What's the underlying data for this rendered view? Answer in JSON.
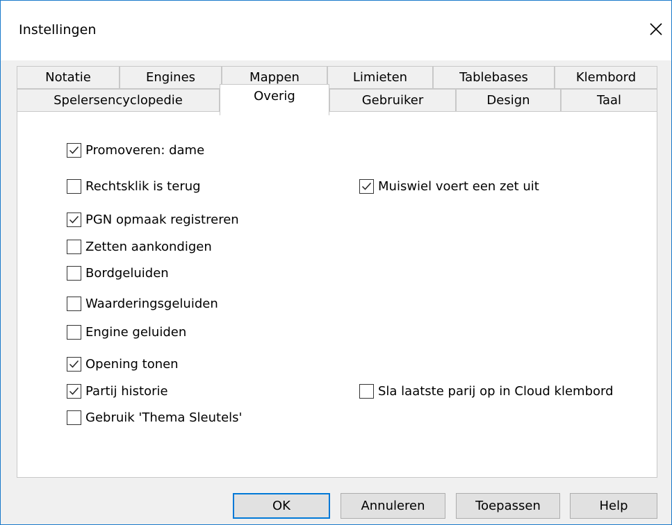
{
  "window": {
    "title": "Instellingen"
  },
  "tabs_row1": [
    "Notatie",
    "Engines",
    "Mappen",
    "Limieten",
    "Tablebases",
    "Klembord"
  ],
  "tabs_row2": [
    "Spelersencyclopedie",
    "Overig",
    "Gebruiker",
    "Design",
    "Taal"
  ],
  "selected_tab": "Overig",
  "options": [
    {
      "label": "Promoveren: dame",
      "checked": true
    },
    {
      "label": "Rechtsklik is terug",
      "checked": false
    },
    {
      "label": "Muiswiel voert een zet uit",
      "checked": true
    },
    {
      "label": "PGN opmaak registreren",
      "checked": true
    },
    {
      "label": "Zetten aankondigen",
      "checked": false
    },
    {
      "label": "Bordgeluiden",
      "checked": false
    },
    {
      "label": "Waarderingsgeluiden",
      "checked": false
    },
    {
      "label": "Engine geluiden",
      "checked": false
    },
    {
      "label": "Opening tonen",
      "checked": true
    },
    {
      "label": "Partij historie",
      "checked": true
    },
    {
      "label": "Sla laatste parij op in Cloud klembord",
      "checked": false
    },
    {
      "label": "Gebruik 'Thema Sleutels'",
      "checked": false
    }
  ],
  "buttons": {
    "ok": "OK",
    "cancel": "Annuleren",
    "apply": "Toepassen",
    "help": "Help"
  },
  "icons": {
    "close": "close-icon",
    "check": "checkmark-icon"
  },
  "colors": {
    "accent": "#0078d7",
    "window_border": "#1979ca"
  }
}
